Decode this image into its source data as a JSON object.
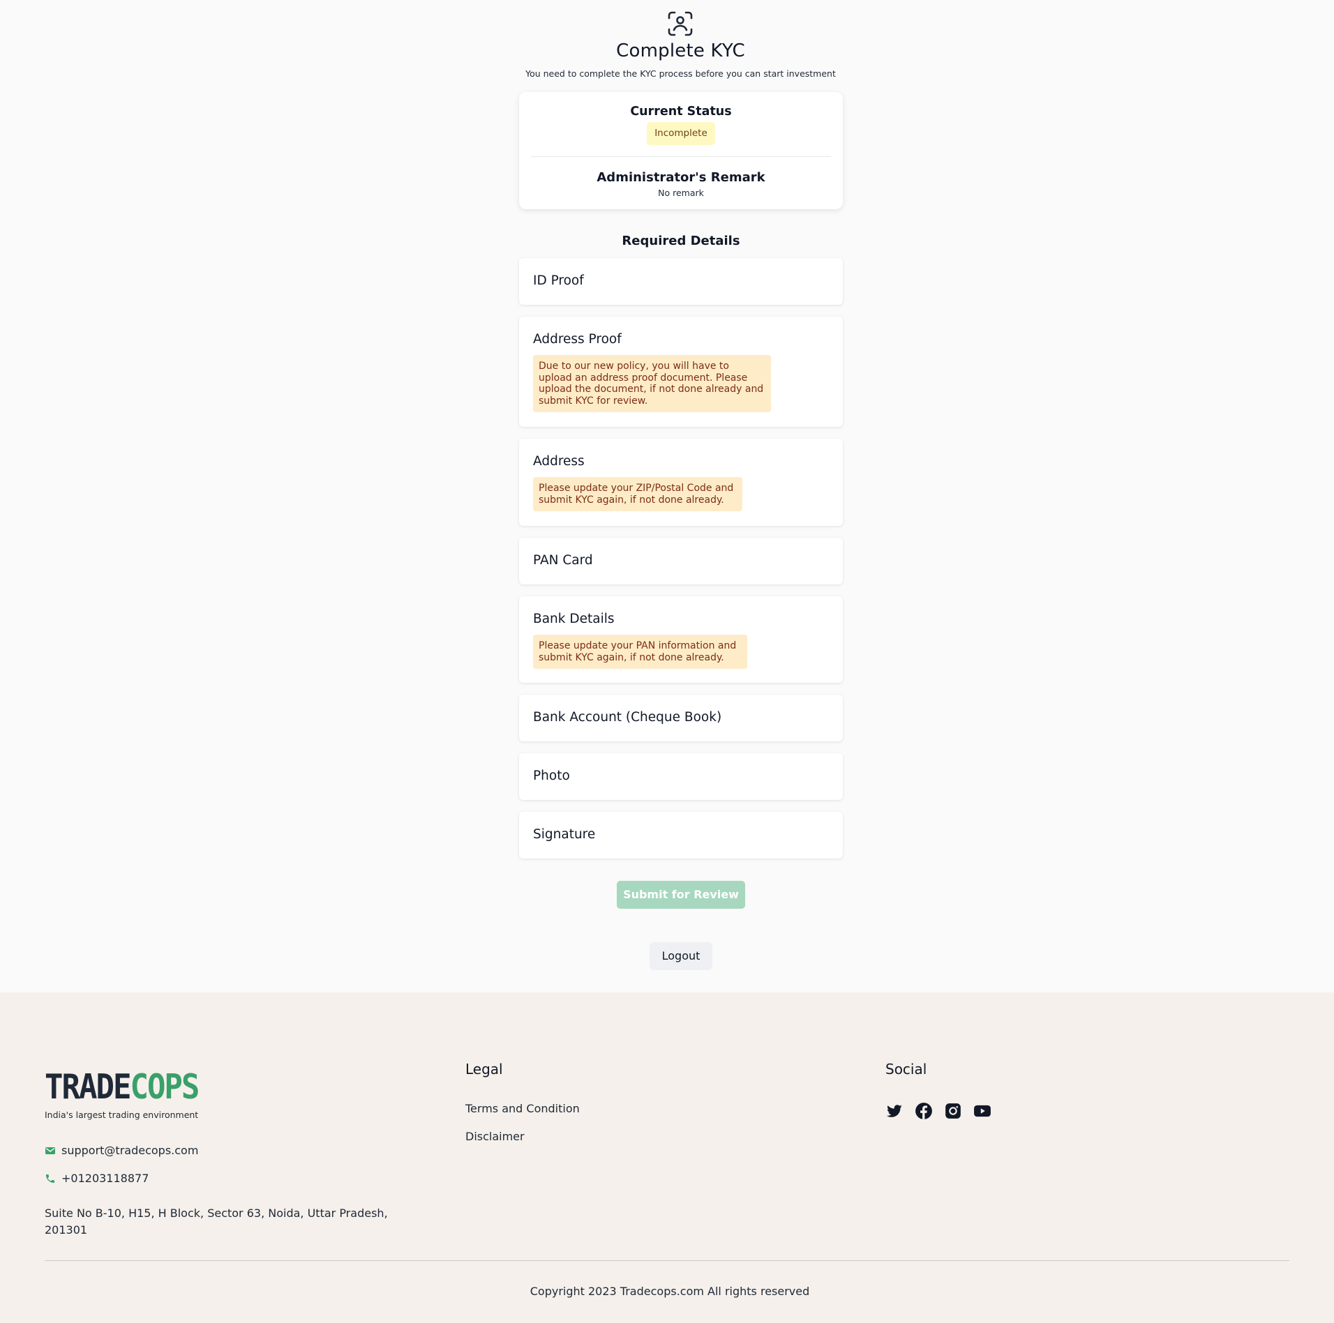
{
  "header": {
    "icon": "face-scan-icon",
    "title": "Complete KYC",
    "subtitle": "You need to complete the KYC process before you can start investment"
  },
  "status": {
    "current_label": "Current Status",
    "current_value": "Incomplete",
    "remark_label": "Administrator's Remark",
    "remark_value": "No remark"
  },
  "required": {
    "heading": "Required Details",
    "items": [
      {
        "label": "ID Proof"
      },
      {
        "label": "Address Proof",
        "notice": "Due to our new policy, you will have to upload an address proof document. Please upload the document, if not done already and submit KYC for review."
      },
      {
        "label": "Address",
        "notice": "Please update your ZIP/Postal Code and submit KYC again, if not done already."
      },
      {
        "label": "PAN Card"
      },
      {
        "label": "Bank Details",
        "notice": "Please update your PAN information and submit KYC again, if not done already."
      },
      {
        "label": "Bank Account (Cheque Book)"
      },
      {
        "label": "Photo"
      },
      {
        "label": "Signature"
      }
    ]
  },
  "actions": {
    "submit_label": "Submit for Review",
    "logout_label": "Logout"
  },
  "footer": {
    "logo_part1": "TRADE",
    "logo_part2": "COPS",
    "tagline": "India's largest trading environment",
    "email": "support@tradecops.com",
    "phone": "+01203118877",
    "address": "Suite No B-10, H15, H Block, Sector 63, Noida, Uttar Pradesh, 201301",
    "legal_heading": "Legal",
    "legal_links": [
      "Terms and Condition",
      "Disclaimer"
    ],
    "social_heading": "Social",
    "social_icons": [
      "twitter-icon",
      "facebook-icon",
      "instagram-icon",
      "youtube-icon"
    ],
    "copyright": "Copyright 2023 Tradecops.com All rights reserved"
  },
  "colors": {
    "brand_green": "#3aa06a",
    "notice_bg": "#feecc8",
    "badge_bg": "#fef9c3"
  }
}
